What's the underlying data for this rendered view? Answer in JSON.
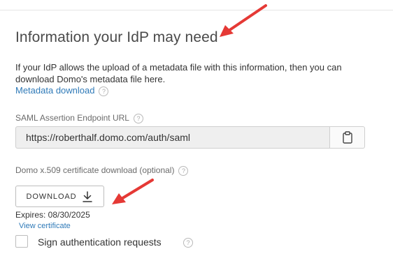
{
  "section": {
    "heading": "Information your IdP may need",
    "description": "If your IdP allows the upload of a metadata file with this information, then you can download Domo's metadata file here.",
    "metadata_link": "Metadata download"
  },
  "saml": {
    "label": "SAML Assertion Endpoint URL",
    "url": "https://roberthalf.domo.com/auth/saml",
    "copy_icon": "clipboard-icon"
  },
  "certificate": {
    "label": "Domo x.509 certificate download (optional)",
    "download_label": "DOWNLOAD",
    "expires": "Expires: 08/30/2025",
    "view_link": "View certificate"
  },
  "sign_requests": {
    "label": "Sign authentication requests",
    "checked": false
  },
  "help_glyph": "?",
  "colors": {
    "link": "#2f7ab8",
    "annotation_arrow": "#e53935",
    "field_bg": "#efefef"
  }
}
